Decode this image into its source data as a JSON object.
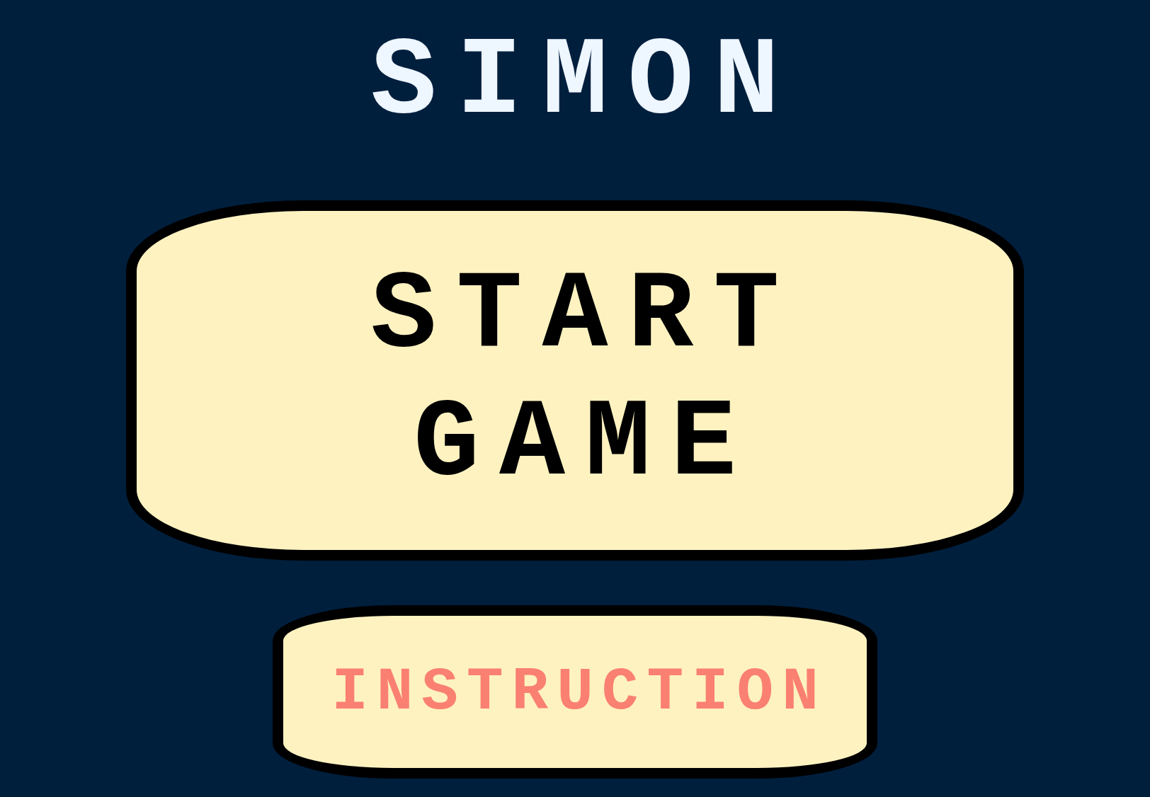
{
  "title": "SIMON",
  "start_button": {
    "label": "START GAME"
  },
  "instruction_button": {
    "label": "INSTRUCTION"
  }
}
